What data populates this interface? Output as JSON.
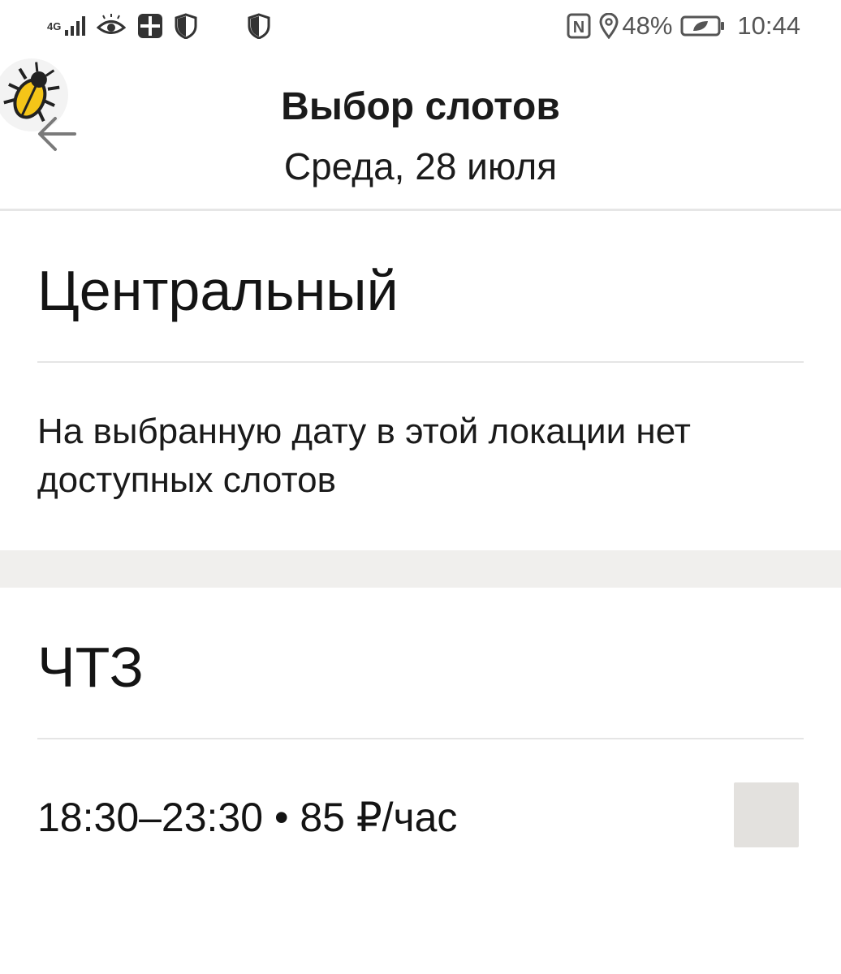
{
  "status_bar": {
    "network_label": "4G",
    "icons_left": [
      "signal-icon",
      "eye-icon",
      "app-icon",
      "shield-icon",
      "shield-icon"
    ],
    "nfc_label": "N",
    "battery_percent": "48%",
    "time": "10:44"
  },
  "header": {
    "title": "Выбор слотов",
    "subtitle": "Среда, 28 июля"
  },
  "locations": [
    {
      "name": "Центральный",
      "message": "На выбранную дату в этой локации нет доступных слотов"
    },
    {
      "name": "ЧТЗ",
      "slots": [
        {
          "label": "18:30–23:30 • 85 ₽/час",
          "selected": false
        }
      ]
    }
  ],
  "colors": {
    "text": "#141414",
    "divider": "#e5e5e5",
    "section_gap": "#f0efed",
    "checkbox": "#e3e1de",
    "bug_yellow": "#f5c518"
  }
}
